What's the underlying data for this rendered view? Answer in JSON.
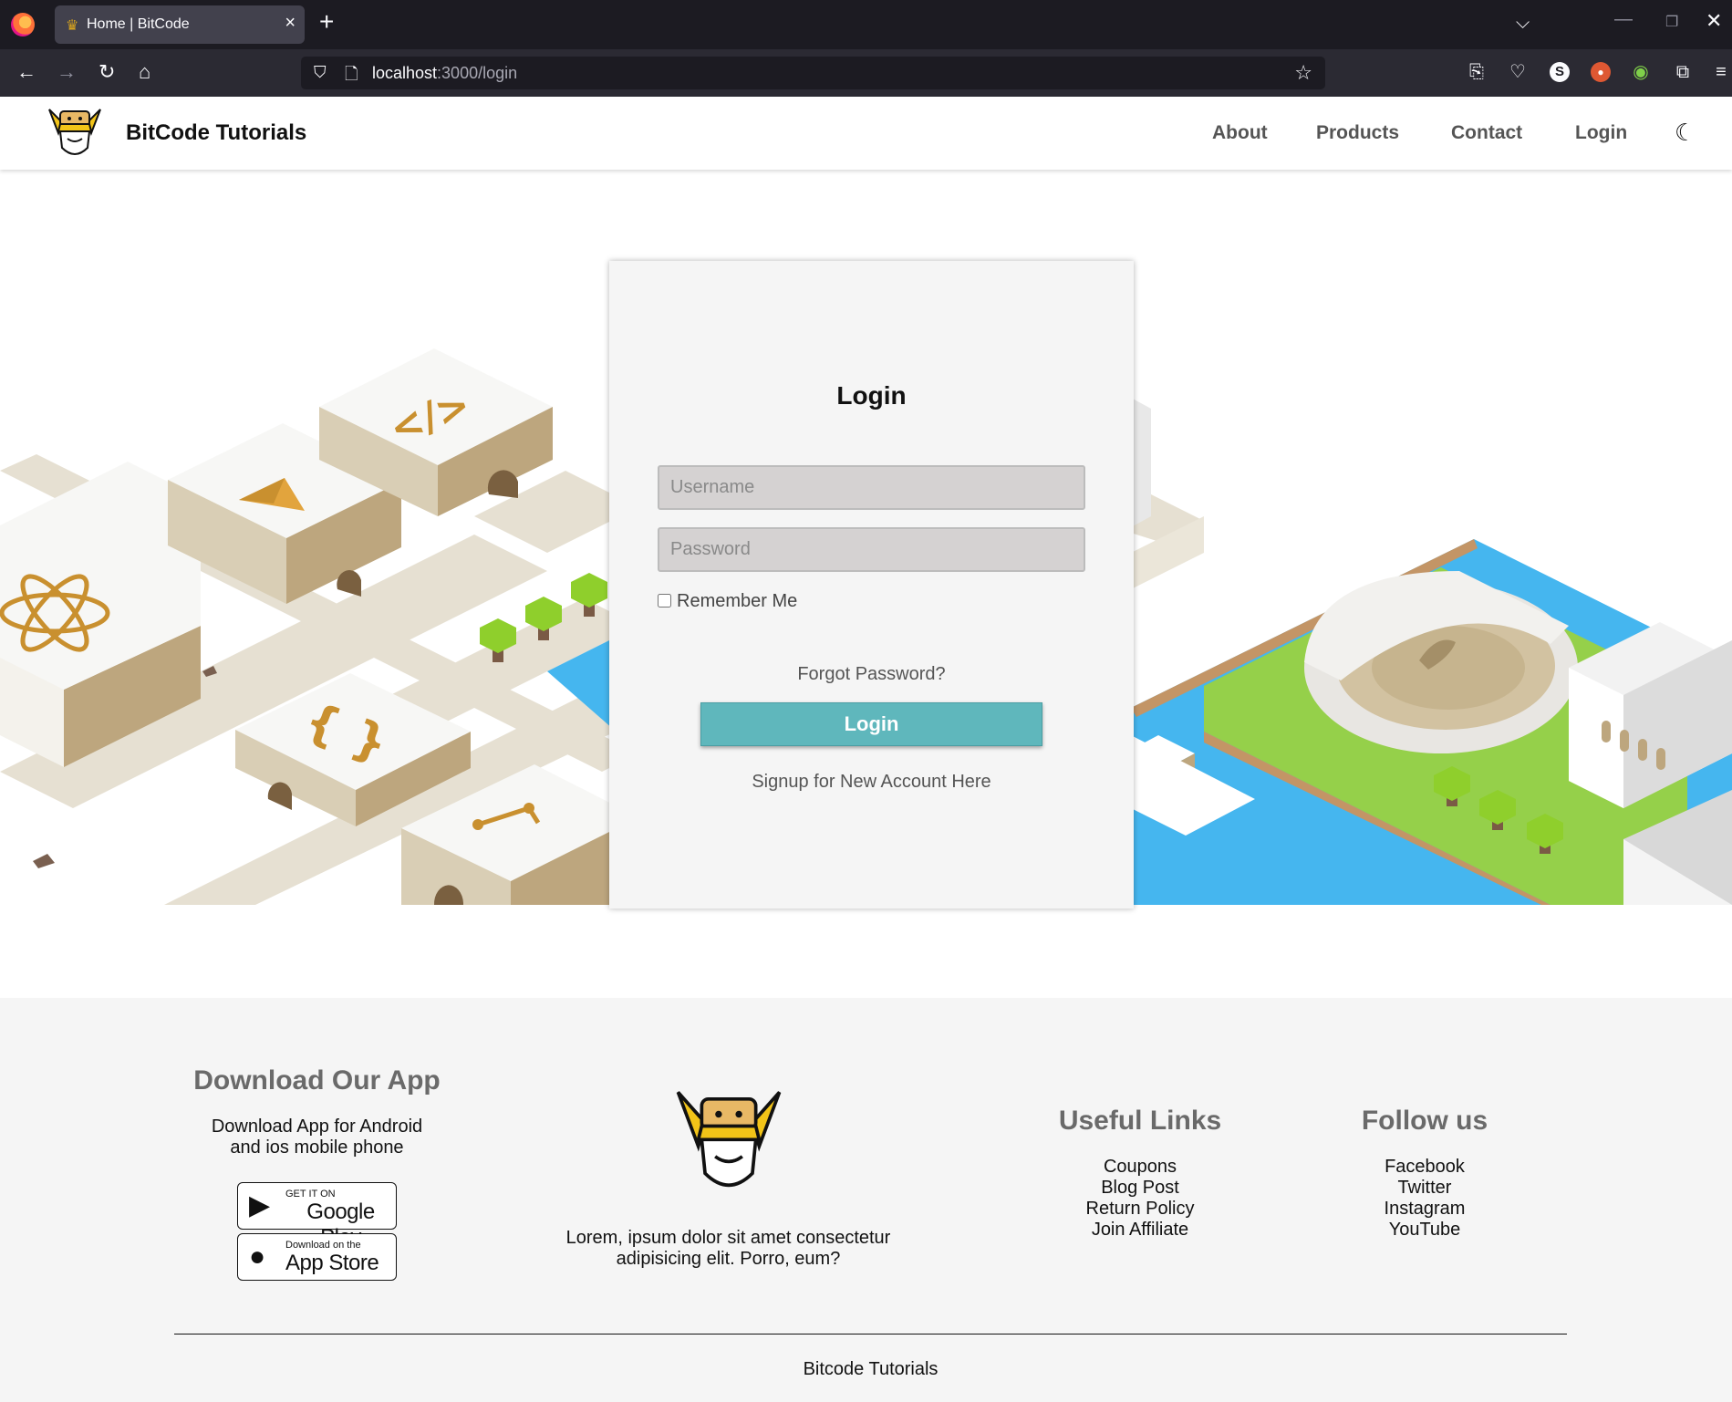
{
  "browser": {
    "tab_title": "Home | BitCode",
    "url_host": "localhost",
    "url_rest": ":3000/login"
  },
  "header": {
    "brand": "BitCode Tutorials",
    "nav": [
      "About",
      "Products",
      "Contact",
      "Login"
    ]
  },
  "login": {
    "title": "Login",
    "username_placeholder": "Username",
    "password_placeholder": "Password",
    "remember_label": "Remember Me",
    "forgot_label": "Forgot Password?",
    "submit_label": "Login",
    "signup_label": "Signup for New Account Here"
  },
  "footer": {
    "app": {
      "heading": "Download Our App",
      "text_line1": "Download App for Android",
      "text_line2": "and ios mobile phone",
      "google_small": "GET IT ON",
      "google_big": "Google Play",
      "apple_small": "Download on the",
      "apple_big": "App Store"
    },
    "about_line1": "Lorem, ipsum dolor sit amet consectetur",
    "about_line2": "adipisicing elit. Porro, eum?",
    "links": {
      "heading": "Useful Links",
      "items": [
        "Coupons",
        "Blog Post",
        "Return Policy",
        "Join Affiliate"
      ]
    },
    "social": {
      "heading": "Follow us",
      "items": [
        "Facebook",
        "Twitter",
        "Instagram",
        "YouTube"
      ]
    },
    "copyright": "Bitcode Tutorials"
  },
  "colors": {
    "accent": "#5fb7bc",
    "water": "#45b6ef",
    "grass": "#95d04a",
    "sand": "#bda67e"
  },
  "icons": {
    "brand_logo": "king-mascot-icon",
    "theme_toggle": "moon-icon"
  }
}
